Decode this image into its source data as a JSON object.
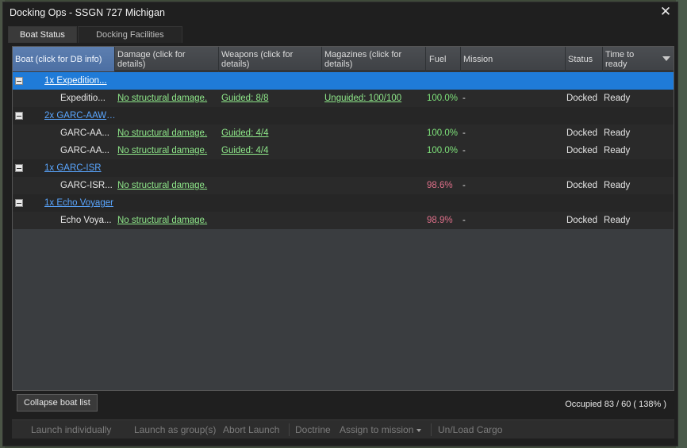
{
  "window": {
    "title": "Docking Ops - SSGN 727 Michigan",
    "close_glyph": "✕"
  },
  "tabs": [
    {
      "label": "Boat Status",
      "active": true
    },
    {
      "label": "Docking Facilities",
      "active": false
    }
  ],
  "columns": {
    "boat": "Boat (click for DB info)",
    "damage": "Damage (click for details)",
    "weapons": "Weapons (click for details)",
    "magazines": "Magazines (click for details)",
    "fuel": "Fuel",
    "mission": "Mission",
    "status": "Status",
    "time": "Time to ready"
  },
  "groups": [
    {
      "label": "1x Expedition...",
      "selected": true,
      "boats": [
        {
          "name": "Expeditio...",
          "damage": "No structural damage.",
          "weapons": "Guided: 8/8",
          "magazines": "Unguided: 100/100",
          "fuel": "100.0%",
          "mission": "-",
          "status": "Docked",
          "time": "Ready"
        }
      ]
    },
    {
      "label": "2x GARC-AAW ...",
      "selected": false,
      "boats": [
        {
          "name": "GARC-AA...",
          "damage": "No structural damage.",
          "weapons": "Guided: 4/4",
          "magazines": "",
          "fuel": "100.0%",
          "mission": "-",
          "status": "Docked",
          "time": "Ready"
        },
        {
          "name": "GARC-AA...",
          "damage": "No structural damage.",
          "weapons": "Guided: 4/4",
          "magazines": "",
          "fuel": "100.0%",
          "mission": "-",
          "status": "Docked",
          "time": "Ready"
        }
      ]
    },
    {
      "label": "1x GARC-ISR",
      "selected": false,
      "boats": [
        {
          "name": "GARC-ISR...",
          "damage": "No structural damage.",
          "weapons": "",
          "magazines": "",
          "fuel": "98.6%",
          "mission": "-",
          "status": "Docked",
          "time": "Ready"
        }
      ]
    },
    {
      "label": "1x Echo Voyager",
      "selected": false,
      "boats": [
        {
          "name": "Echo Voya...",
          "damage": "No structural damage.",
          "weapons": "",
          "magazines": "",
          "fuel": "98.9%",
          "mission": "-",
          "status": "Docked",
          "time": "Ready"
        }
      ]
    }
  ],
  "footer": {
    "collapse_label": "Collapse boat list",
    "occupied": "Occupied 83 / 60 ( 138% )"
  },
  "actions": {
    "launch_individually": "Launch individually",
    "launch_group": "Launch as group(s)",
    "abort": "Abort Launch",
    "doctrine": "Doctrine",
    "assign": "Assign to mission",
    "cargo": "Un/Load Cargo"
  },
  "colors": {
    "selected_row": "#1f7bd8",
    "link_green": "#8fe88a",
    "fuel_full": "#7ee27a",
    "fuel_partial": "#e0708a",
    "group_link": "#5aa6ff"
  }
}
